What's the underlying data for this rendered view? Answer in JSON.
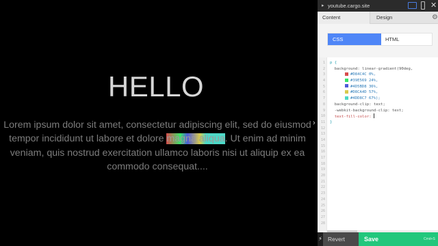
{
  "preview": {
    "heading": "HELLO",
    "paragraph_before": "Lorem ipsum dolor sit amet, consectetur adipiscing elit, sed do eiusmod tempor incididunt ut labore et dolore ",
    "paragraph_highlight": "magna aliqua",
    "paragraph_after": ". Ut enim ad minim veniam, quis nostrud exercitation ullamco laboris nisi ut aliquip ex ea commodo consequat....",
    "expand_arrow": "›"
  },
  "editor": {
    "site_url": "youtube.cargo.site",
    "site_caret": "▸",
    "close": "✕",
    "tabs": {
      "content": "Content",
      "design": "Design"
    },
    "gear": "⚙",
    "modes": {
      "css": "CSS",
      "html": "HTML"
    },
    "code_lines": [
      {
        "n": "1",
        "text": "p {"
      },
      {
        "n": "2",
        "text": "  background: linear-gradient(90deg,"
      },
      {
        "n": "3",
        "text": "#D84C4C 0%,"
      },
      {
        "n": "4",
        "text": "#39E569 24%,"
      },
      {
        "n": "5",
        "text": "#4D5BD8 36%,"
      },
      {
        "n": "6",
        "text": "#D8CA4D 57%,"
      },
      {
        "n": "7",
        "text": "#4DD8C7 67%);"
      },
      {
        "n": "8",
        "text": "  background-clip: text;"
      },
      {
        "n": "9",
        "text": "  -webkit-background-clip: text;"
      },
      {
        "n": "10",
        "text": "  text-fill-color: "
      },
      {
        "n": "11",
        "text": "}"
      }
    ],
    "empty_line_numbers": [
      "12",
      "13",
      "14",
      "15",
      "16",
      "17",
      "18",
      "19",
      "20",
      "21",
      "22",
      "23",
      "24",
      "25",
      "26",
      "27",
      "28"
    ],
    "swatch_colors": [
      "#D84C4C",
      "#39E569",
      "#4D5BD8",
      "#D8CA4D",
      "#4DD8C7"
    ],
    "lightning": "⚡",
    "revert": "Revert",
    "save": "Save",
    "save_note": "Cmd+S"
  },
  "colors": {
    "accent_blue": "#4f86f7",
    "save_green": "#22c77c"
  }
}
